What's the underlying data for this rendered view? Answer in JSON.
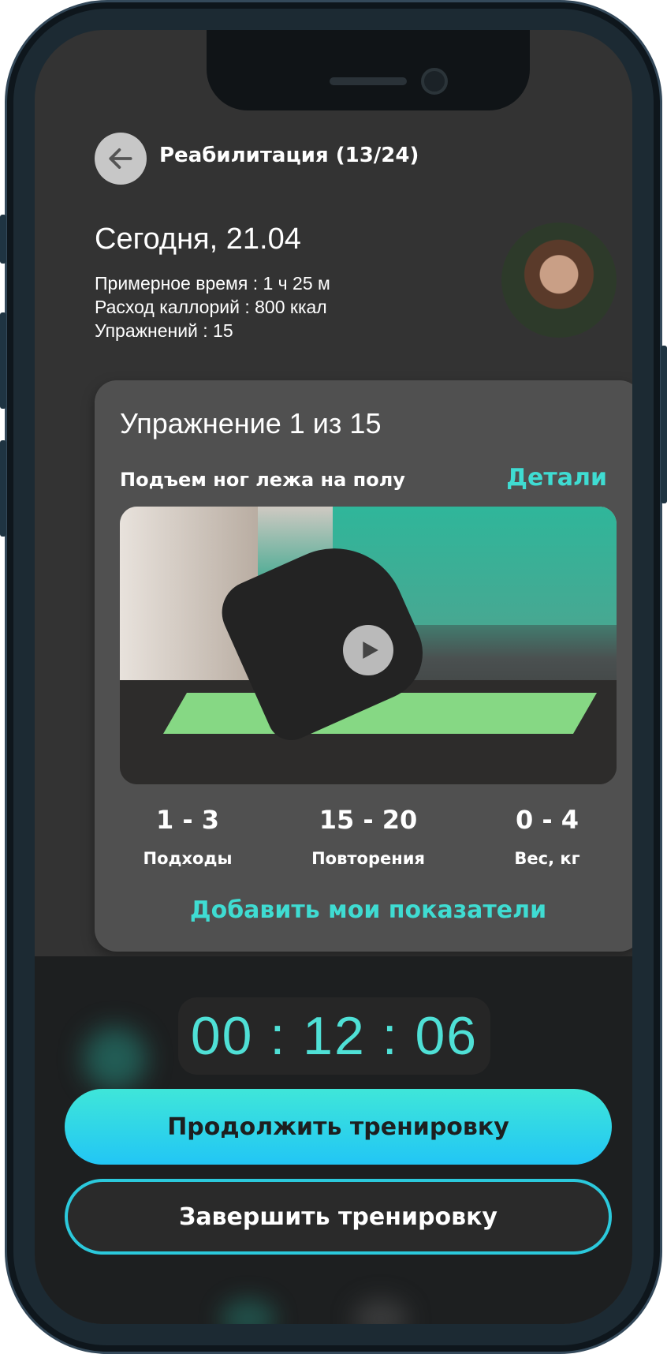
{
  "header": {
    "title": "Реабилитация (13/24)",
    "back_icon": "arrow-left-icon"
  },
  "summary": {
    "date": "Сегодня, 21.04",
    "time_estimate": "Примерное время : 1 ч 25 м",
    "calories": "Расход каллорий : 800 ккал",
    "exercises": "Упражнений : 15"
  },
  "exercise": {
    "counter": "Упражнение 1 из 15",
    "name": "Подъем ног лежа на полу",
    "details_label": "Детали",
    "metrics": [
      {
        "value": "1 - 3",
        "label": "Подходы"
      },
      {
        "value": "15 - 20",
        "label": "Повторения"
      },
      {
        "value": "0 - 4",
        "label": "Вес, кг"
      }
    ],
    "add_label": "Добавить мои показатели"
  },
  "timer": {
    "display": "00 : 12 : 06"
  },
  "actions": {
    "continue_label": "Продолжить тренировку",
    "finish_label": "Завершить тренировку"
  },
  "colors": {
    "accent": "#3fdcd2",
    "background": "#333333",
    "card": "#505050"
  }
}
